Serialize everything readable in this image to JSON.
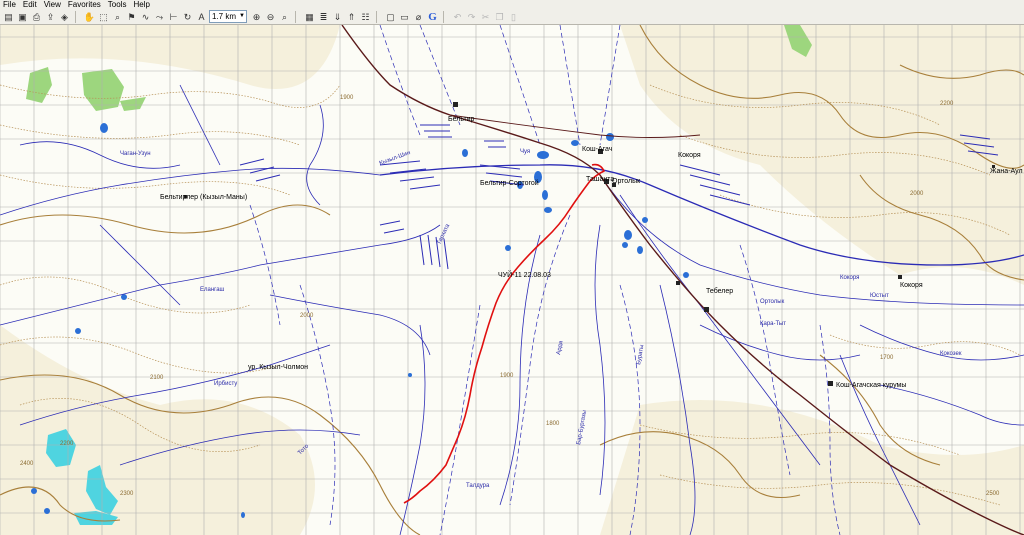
{
  "menu": [
    "File",
    "Edit",
    "View",
    "Favorites",
    "Tools",
    "Help"
  ],
  "toolbar": {
    "zoom_value": "1.7 km",
    "icons": [
      "open-icon",
      "save-icon",
      "print-icon",
      "export-icon",
      "gps-icon",
      "hand-tool-icon",
      "select-tool-icon",
      "zoom-tool-icon",
      "waypoint-tool-icon",
      "track-tool-icon",
      "route-tool-icon",
      "measure-tool-icon",
      "rotate-icon",
      "text-tool-icon",
      "zoom-in-icon",
      "zoom-out-icon",
      "find-icon",
      "grid-icon",
      "layers-icon",
      "gps-receive-icon",
      "gps-send-icon",
      "properties-icon",
      "page-icon",
      "document-icon",
      "attach-icon",
      "google-icon",
      "undo-icon",
      "redo-icon",
      "cut-icon",
      "copy-icon",
      "paste-icon"
    ]
  },
  "map": {
    "place_labels": [
      {
        "id": "settlement-1",
        "text": "Бельтир"
      },
      {
        "id": "settlement-2",
        "text": "Кош-Агач"
      },
      {
        "id": "settlement-3",
        "text": "Тебелер"
      },
      {
        "id": "settlement-4",
        "text": "Бельтирлер (Кызыл-Маны)"
      },
      {
        "id": "settlement-5",
        "text": "Кокоря"
      },
      {
        "id": "settlement-6",
        "text": "Ортолык"
      },
      {
        "id": "settlement-7",
        "text": "Жана-Аул"
      },
      {
        "id": "place-1",
        "text": "Кош-Агачская курумы"
      },
      {
        "id": "place-2",
        "text": "Ташанта"
      },
      {
        "id": "place-3",
        "text": "Кокоря"
      },
      {
        "id": "place-4",
        "text": "Бельтир-Сортогой"
      },
      {
        "id": "place-5",
        "text": "ур. Кызыл-Чолмон"
      }
    ],
    "track_label": "ЧУЙ-11 22.08.03",
    "river_labels": [
      "Чуя",
      "Тархата",
      "Елангаш",
      "Кокоря",
      "Юстыт",
      "Талдура",
      "Ирбисту",
      "Чаган-Узун",
      "Кызыл-Шин",
      "Кокозек",
      "Кара-Тыт",
      "Тото",
      "Арда",
      "Бар-Бургазы",
      "Бураты",
      "Ортолык"
    ],
    "contour_labels": [
      "1900",
      "2000",
      "2100",
      "2200",
      "2300",
      "2400",
      "2500",
      "2000",
      "2200",
      "1900",
      "1800",
      "1700"
    ],
    "colors": {
      "road": "#5a1a1a",
      "track": "#e01010",
      "river": "#2b2bb5",
      "contour": "#b69055",
      "grid": "#aaaaaa",
      "lake": "#2b6fd6",
      "vegetation": "#9dd67e",
      "glacier": "#4fd4e0"
    }
  }
}
